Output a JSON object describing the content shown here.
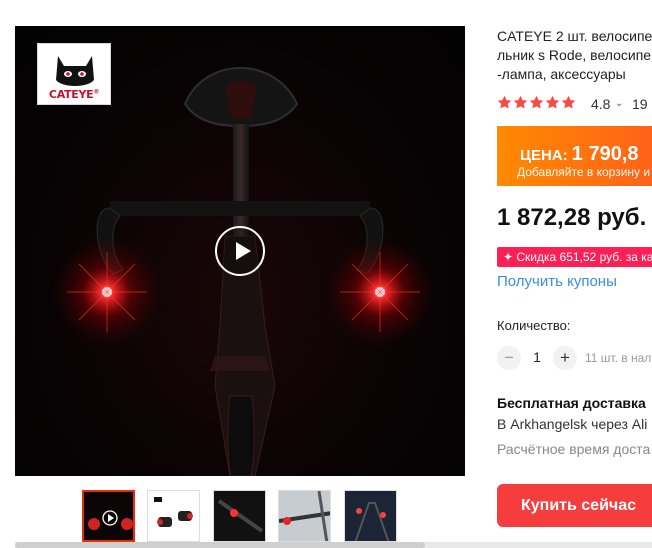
{
  "logo": {
    "text": "CATEYE",
    "reg": "®"
  },
  "video": {
    "play_icon": "play-icon"
  },
  "thumbnails": [
    {
      "name": "thumb-1",
      "active": true
    },
    {
      "name": "thumb-2",
      "active": false
    },
    {
      "name": "thumb-3",
      "active": false
    },
    {
      "name": "thumb-4",
      "active": false
    },
    {
      "name": "thumb-5",
      "active": false
    }
  ],
  "product": {
    "title": "CATEYE 2 шт. велосипе\nльник s Rode, велосипе\n-лампа, аксессуары"
  },
  "rating": {
    "value": "4.8",
    "chevron": "⌄",
    "reviews": "19 (",
    "stars": 5,
    "star_color": "#ff4747"
  },
  "price_banner": {
    "label": "ЦЕНА: ",
    "value": "1 790,8",
    "note": "Добавляйте в корзину и",
    "gradient_start": "#ff8a00",
    "gradient_end": "#ff5e1a"
  },
  "main_price": "1 872,28 руб.",
  "discount": "✦ Скидка 651,52 руб. за ка",
  "coupons_link": "Получить купоны",
  "quantity": {
    "label": "Количество:",
    "minus": "−",
    "value": "1",
    "plus": "+",
    "available": "11 шт. в нал"
  },
  "shipping": {
    "title": "Бесплатная доставка",
    "route": "В Arkhangelsk через Ali",
    "time": "Расчётное время доста"
  },
  "buy_button": "Купить сейчас",
  "colors": {
    "accent": "#f53d3d",
    "link": "#3a8fd8",
    "discount": "#ff1f54"
  }
}
